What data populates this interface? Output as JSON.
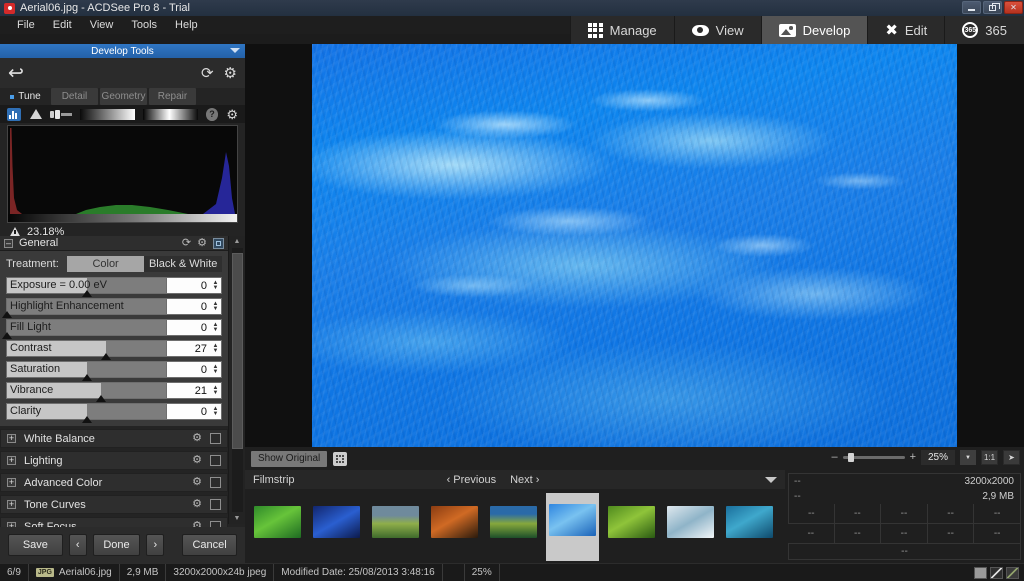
{
  "window": {
    "title": "Aerial06.jpg - ACDSee Pro 8 - Trial",
    "app_icon": "camera-icon",
    "minimize": "minimize-icon",
    "restore": "restore-icon",
    "close": "✕"
  },
  "menu": {
    "items": [
      "File",
      "Edit",
      "View",
      "Tools",
      "Help"
    ]
  },
  "modes": [
    {
      "label": "Manage",
      "icon": "grid-icon",
      "active": false
    },
    {
      "label": "View",
      "icon": "eye-icon",
      "active": false
    },
    {
      "label": "Develop",
      "icon": "picture-icon",
      "active": true
    },
    {
      "label": "Edit",
      "icon": "tools-icon",
      "active": false
    },
    {
      "label": "365",
      "icon": "365-icon",
      "active": false
    }
  ],
  "develop_tools": {
    "header": "Develop Tools",
    "undo_icon": "undo-arrow-icon",
    "refresh_icon": "refresh-icon",
    "settings_icon": "gear-icon",
    "tabs": [
      {
        "label": "Tune",
        "active": true
      },
      {
        "label": "Detail",
        "active": false
      },
      {
        "label": "Geometry",
        "active": false
      },
      {
        "label": "Repair",
        "active": false
      }
    ]
  },
  "histogram": {
    "tools": [
      "histogram-icon",
      "clipping-warning-icon",
      "brush-icon",
      "gradient-bar-1",
      "gradient-bar-2",
      "help-icon",
      "gear-icon"
    ],
    "clipping_percent": "23.18%"
  },
  "general": {
    "title": "General",
    "collapse_glyph": "–",
    "treatment_label": "Treatment:",
    "treatment_options": [
      {
        "label": "Color",
        "selected": true
      },
      {
        "label": "Black & White",
        "selected": false
      }
    ],
    "sliders": [
      {
        "label": "Exposure = 0.00 eV",
        "value": "0",
        "pos": 50
      },
      {
        "label": "Highlight Enhancement",
        "value": "0",
        "pos": 0
      },
      {
        "label": "Fill Light",
        "value": "0",
        "pos": 0
      },
      {
        "label": "Contrast",
        "value": "27",
        "pos": 62
      },
      {
        "label": "Saturation",
        "value": "0",
        "pos": 50
      },
      {
        "label": "Vibrance",
        "value": "21",
        "pos": 59
      },
      {
        "label": "Clarity",
        "value": "0",
        "pos": 50
      }
    ]
  },
  "collapsed_panels": [
    {
      "label": "White Balance",
      "expand_glyph": "+"
    },
    {
      "label": "Lighting",
      "expand_glyph": "+"
    },
    {
      "label": "Advanced Color",
      "expand_glyph": "+"
    },
    {
      "label": "Tone Curves",
      "expand_glyph": "+"
    },
    {
      "label": "Soft Focus",
      "expand_glyph": "+"
    }
  ],
  "buttons": {
    "save": "Save",
    "prev": "‹",
    "done": "Done",
    "next": "›",
    "cancel": "Cancel"
  },
  "viewer": {
    "show_original": "Show Original",
    "expand_icon": "expand-icon",
    "zoom_minus": "–",
    "zoom_plus": "+",
    "zoom_value": "25%",
    "dropdown_glyph": "▼",
    "actual_size": "1:1",
    "fit_icon": "fit-icon"
  },
  "filmstrip": {
    "title": "Filmstrip",
    "previous": "‹ Previous",
    "next": "Next ›",
    "caret": "▼",
    "thumbnails": [
      {
        "name": "thumb-1",
        "colors": [
          "#2f8a2a",
          "#67c43a",
          "#1e6b22"
        ]
      },
      {
        "name": "thumb-2",
        "colors": [
          "#12266e",
          "#2a5fd0",
          "#0c1a4c"
        ]
      },
      {
        "name": "thumb-3",
        "colors": [
          "#6f8a9c",
          "#8fae4a",
          "#3f6b2c"
        ]
      },
      {
        "name": "thumb-4",
        "colors": [
          "#8a3c12",
          "#d06a24",
          "#2a1a0c"
        ]
      },
      {
        "name": "thumb-5",
        "colors": [
          "#2a6aa8",
          "#86a83c",
          "#1d4f2a"
        ]
      },
      {
        "name": "thumb-6",
        "colors": [
          "#2f86e0",
          "#79c2f0",
          "#1a62b8"
        ],
        "selected": true
      },
      {
        "name": "thumb-7",
        "colors": [
          "#4f8a1e",
          "#8fc43a",
          "#2a5a12"
        ]
      },
      {
        "name": "thumb-8",
        "colors": [
          "#dfe8ee",
          "#8fb4c8",
          "#f2f6f8"
        ]
      },
      {
        "name": "thumb-9",
        "colors": [
          "#1a6f9c",
          "#3fa8cc",
          "#0e4a6c"
        ]
      }
    ]
  },
  "metadata": {
    "row1_left": "--",
    "row1_right": "3200x2000",
    "row2_left": "--",
    "row2_right": "2,9 MB",
    "cells": [
      "--",
      "--",
      "--",
      "--",
      "--",
      "--",
      "--",
      "--",
      "--",
      "--"
    ],
    "footer": "--"
  },
  "statusbar": {
    "index": "6/9",
    "file_type": "JPG",
    "filename": "Aerial06.jpg",
    "filesize": "2,9 MB",
    "dimensions": "3200x2000x24b jpeg",
    "modified": "Modified Date: 25/08/2013 3:48:16",
    "zoom": "25%",
    "view_buttons": [
      "view-mode-1",
      "view-mode-2",
      "view-mode-3"
    ]
  },
  "colors": {
    "accent": "#2f76c4",
    "active_mode": "#545454",
    "panel_bg": "#3a3a3a",
    "close_red": "#d9503c"
  }
}
